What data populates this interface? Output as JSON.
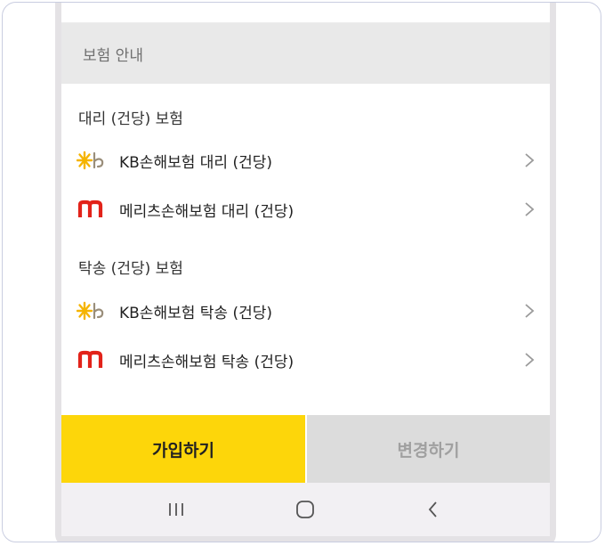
{
  "section_title": "보험 안내",
  "groups": [
    {
      "label": "대리 (건당) 보험",
      "items": [
        {
          "label": "KB손해보험 대리 (건당)",
          "icon": "kb-logo-icon"
        },
        {
          "label": "메리츠손해보험 대리 (건당)",
          "icon": "meritz-logo-icon"
        }
      ]
    },
    {
      "label": "탁송 (건당) 보험",
      "items": [
        {
          "label": "KB손해보험 탁송 (건당)",
          "icon": "kb-logo-icon"
        },
        {
          "label": "메리츠손해보험 탁송 (건당)",
          "icon": "meritz-logo-icon"
        }
      ]
    }
  ],
  "actions": {
    "join_label": "가입하기",
    "change_label": "변경하기"
  },
  "colors": {
    "accent_yellow": "#fdd60a",
    "meritz_red": "#e2231a",
    "kb_yellow": "#f5b400"
  },
  "navbar": {
    "icons": [
      "recent-apps-icon",
      "home-icon",
      "back-icon"
    ]
  }
}
